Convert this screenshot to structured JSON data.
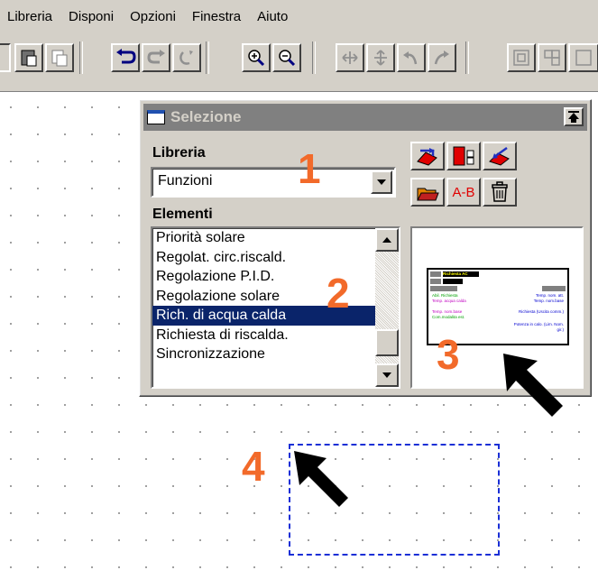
{
  "menu": [
    "Libreria",
    "Disponi",
    "Opzioni",
    "Finestra",
    "Aiuto"
  ],
  "toolbar": {
    "icons": [
      "paste-icon",
      "copy-format-icon",
      "undo-icon",
      "redo-icon",
      "refresh-icon",
      "zoom-in-icon",
      "zoom-out-icon",
      "move-horizontal-icon",
      "move-vertical-icon",
      "rotate-left-icon",
      "rotate-right-icon",
      "group-icon",
      "ungroup-icon"
    ]
  },
  "palette": {
    "title": "Selezione",
    "library_label": "Libreria",
    "library_value": "Funzioni",
    "elements_label": "Elementi",
    "elements": [
      "Priorità solare",
      "Regolat. circ.riscald.",
      "Regolazione P.I.D.",
      "Regolazione solare",
      "Rich. di acqua calda",
      "Richiesta di riscalda.",
      "Sincronizzazione"
    ],
    "selected_index": 4,
    "library_buttons": [
      "edit-library-icon",
      "export-icon",
      "import-icon",
      "open-folder-icon",
      "rename-icon",
      "trash-icon"
    ],
    "ab_label": "A-B",
    "preview": {
      "name": "Richiesta AC",
      "left_inputs": [
        "Abil. Richiesta",
        "Temp. acqua calda",
        "Temp. nom.base",
        "Com.modalita est."
      ],
      "right_outputs": [
        "Temp. nom. att.",
        "Temp. nom.base",
        "Richiesta (Uscita comm.)",
        "Potenza in calo. (Lim. Nom. gir.)"
      ]
    }
  },
  "annotations": [
    "1",
    "2",
    "3",
    "4"
  ],
  "colors": {
    "accent_orange": "#f26a2a",
    "selection": "#0a246a",
    "dashed_box": "#1a2fd6"
  }
}
